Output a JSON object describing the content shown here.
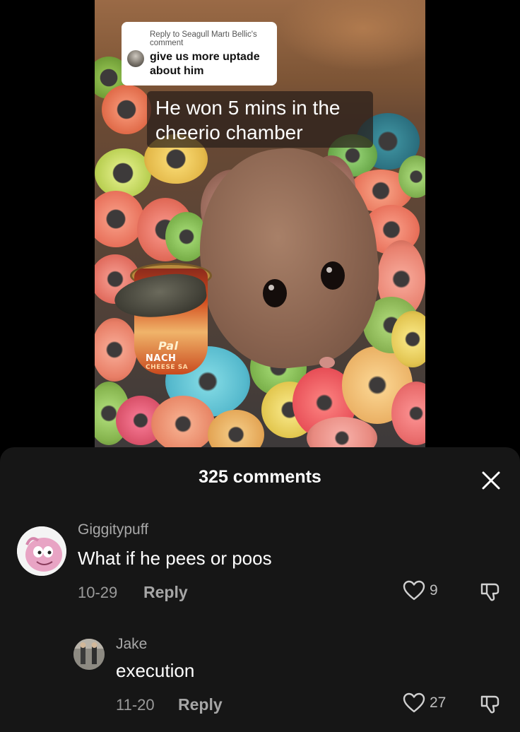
{
  "video": {
    "reply_header": "Reply to Seagull Martı Bellic's comment",
    "reply_text": "give us more uptade about him",
    "caption": "He won 5 mins in the cheerio chamber",
    "cup_label_line1": "Pal",
    "cup_label_line2": "NACH",
    "cup_label_line3": "CHEESE SA"
  },
  "sheet": {
    "title": "325 comments",
    "close_icon": "close-icon"
  },
  "comments": [
    {
      "username": "Giggitypuff",
      "text": "What if he pees or poos",
      "date": "10-29",
      "reply_label": "Reply",
      "likes": "9"
    },
    {
      "username": "Jake",
      "text": "execution",
      "date": "11-20",
      "reply_label": "Reply",
      "likes": "27"
    }
  ],
  "icons": [
    "heart-icon",
    "dislike-icon",
    "close-icon"
  ]
}
